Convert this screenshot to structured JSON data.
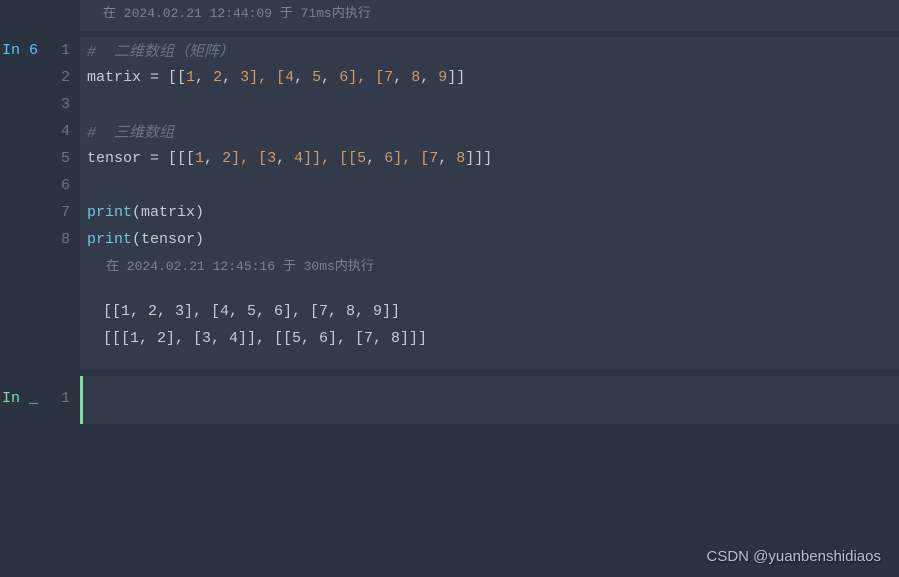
{
  "prev_exec_info": "在 2024.02.21 12:44:09 于 71ms内执行",
  "cell1": {
    "prompt": "In 6",
    "lines": {
      "l1_comment": "#  二维数组（矩阵）",
      "l2_a": "matrix = [[",
      "l2_n1": "1",
      "l2_c1": ", ",
      "l2_n2": "2",
      "l2_c2": ", ",
      "l2_n3": "3",
      "l2_b": "], [",
      "l2_n4": "4",
      "l2_c3": ", ",
      "l2_n5": "5",
      "l2_c4": ", ",
      "l2_n6": "6",
      "l2_c": "], [",
      "l2_n7": "7",
      "l2_c5": ", ",
      "l2_n8": "8",
      "l2_c6": ", ",
      "l2_n9": "9",
      "l2_d": "]]",
      "l4_comment": "#  三维数组",
      "l5_a": "tensor = [[[",
      "l5_n1": "1",
      "l5_c1": ", ",
      "l5_n2": "2",
      "l5_b": "], [",
      "l5_n3": "3",
      "l5_c2": ", ",
      "l5_n4": "4",
      "l5_c": "]], [[",
      "l5_n5": "5",
      "l5_c3": ", ",
      "l5_n6": "6",
      "l5_d": "], [",
      "l5_n7": "7",
      "l5_c4": ", ",
      "l5_n8": "8",
      "l5_e": "]]]",
      "l7_func": "print",
      "l7_arg": "(matrix)",
      "l8_func": "print",
      "l8_arg": "(tensor)"
    },
    "exec_info": "在 2024.02.21 12:45:16 于 30ms内执行",
    "output": {
      "line1": "[[1, 2, 3], [4, 5, 6], [7, 8, 9]]",
      "line2": "[[[1, 2], [3, 4]], [[5, 6], [7, 8]]]"
    }
  },
  "cell2": {
    "prompt": "In _",
    "line_num": "1"
  },
  "nums": {
    "n1": "1",
    "n2": "2",
    "n3": "3",
    "n4": "4",
    "n5": "5",
    "n6": "6",
    "n7": "7",
    "n8": "8"
  },
  "watermark": "CSDN @yuanbenshidiaos"
}
